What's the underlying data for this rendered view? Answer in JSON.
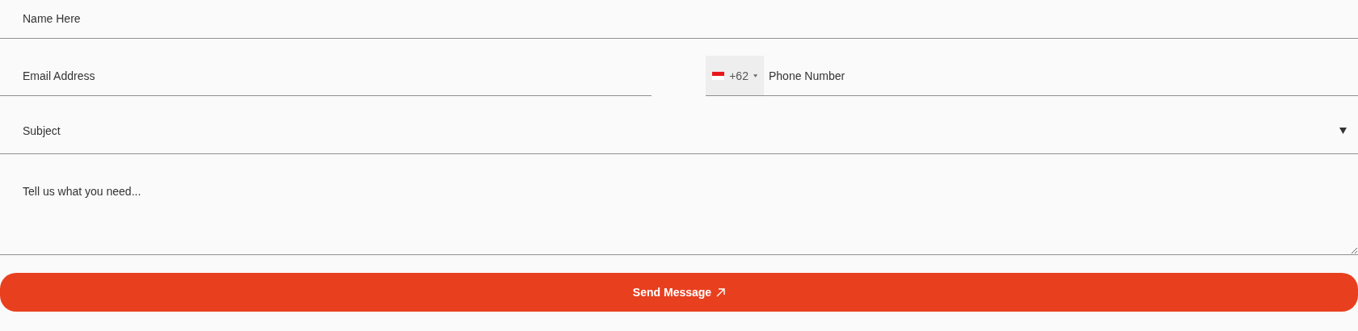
{
  "name_field": {
    "placeholder": "Name Here"
  },
  "email_field": {
    "placeholder": "Email Address"
  },
  "phone_field": {
    "country_code": "+62",
    "placeholder": "Phone Number"
  },
  "subject_field": {
    "value": "Subject"
  },
  "message_field": {
    "placeholder": "Tell us what you need..."
  },
  "submit_button": {
    "label": "Send Message"
  }
}
